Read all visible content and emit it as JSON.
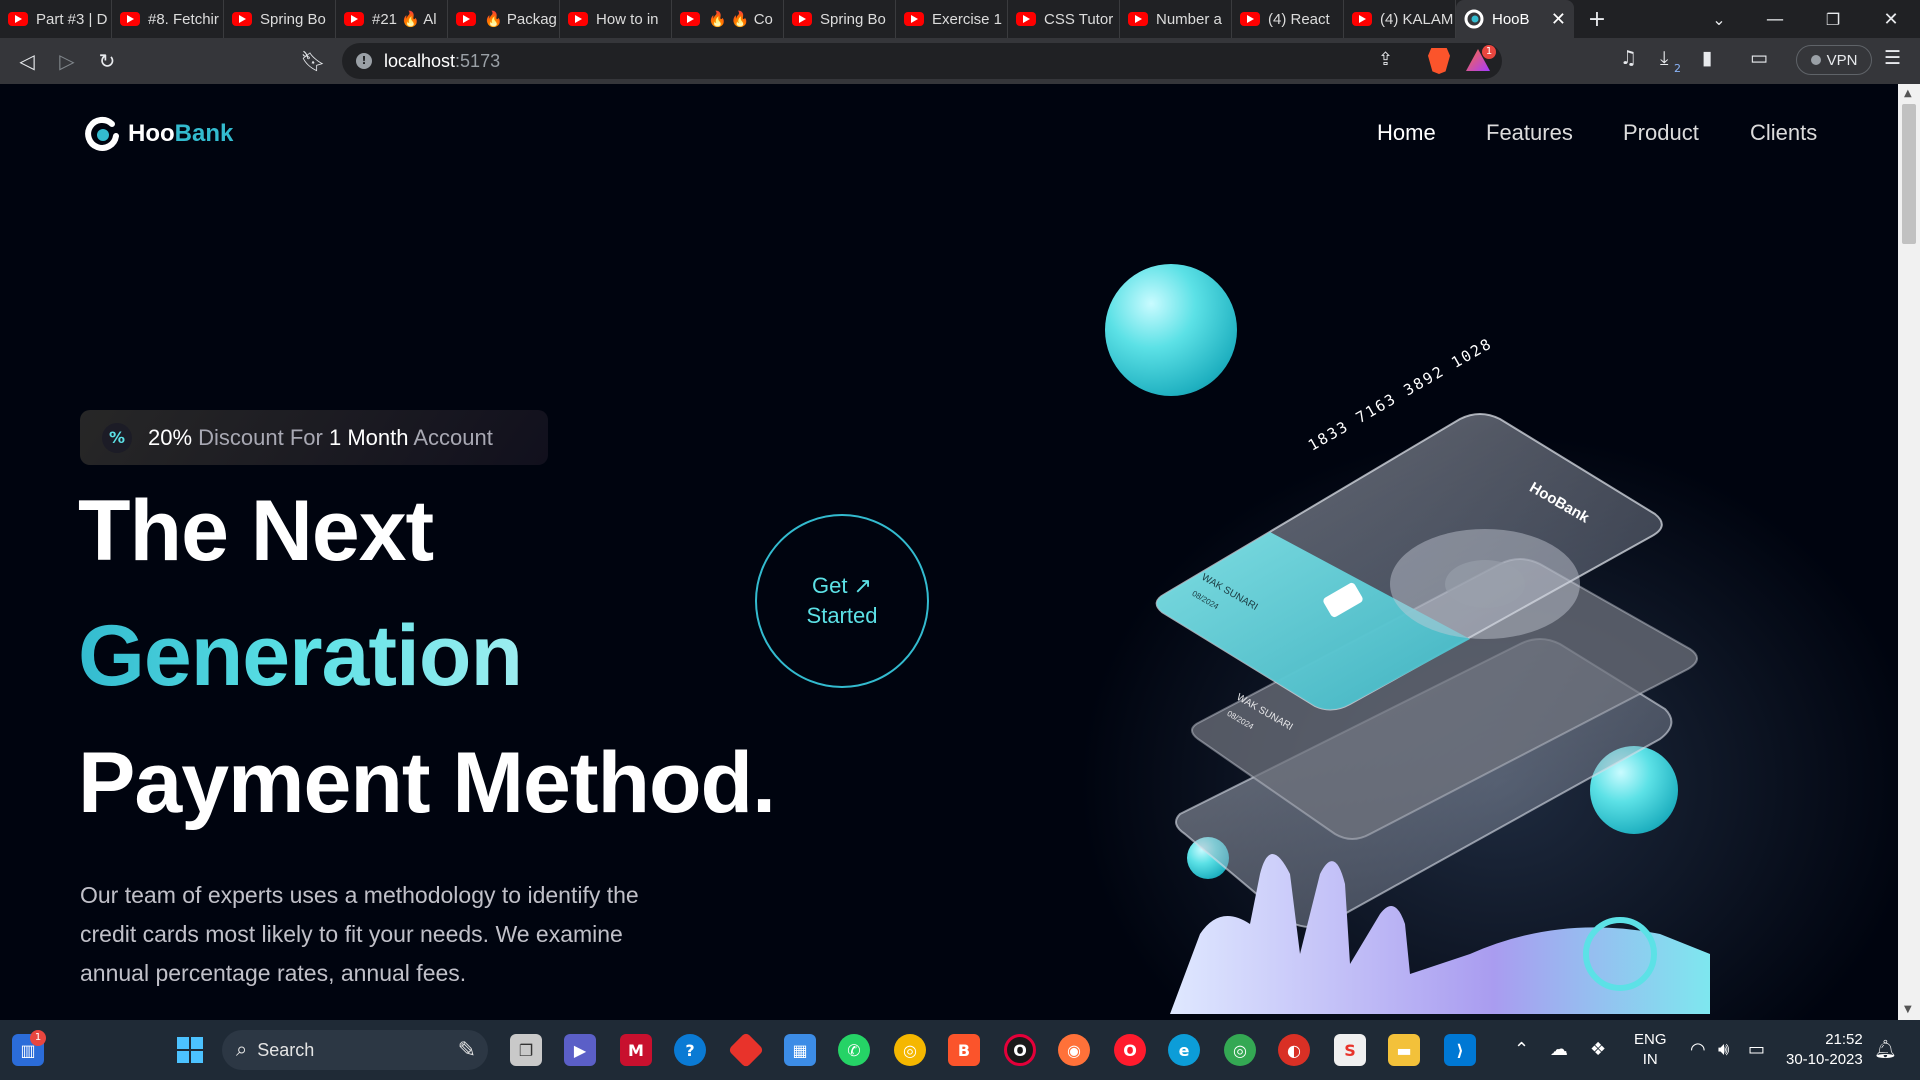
{
  "browser": {
    "tabs": [
      {
        "label": "Part #3 | D",
        "icon": "youtube-icon"
      },
      {
        "label": "#8. Fetchir",
        "icon": "youtube-icon"
      },
      {
        "label": "Spring Bo",
        "icon": "youtube-icon"
      },
      {
        "label": "#21 🔥 Al",
        "icon": "youtube-icon"
      },
      {
        "label": "🔥 Packag",
        "icon": "youtube-icon"
      },
      {
        "label": "How to in",
        "icon": "youtube-icon"
      },
      {
        "label": "🔥 🔥 Co",
        "icon": "youtube-icon"
      },
      {
        "label": "Spring Bo",
        "icon": "youtube-icon"
      },
      {
        "label": "Exercise 1",
        "icon": "youtube-icon"
      },
      {
        "label": "CSS Tutor",
        "icon": "youtube-icon"
      },
      {
        "label": "Number a",
        "icon": "youtube-icon"
      },
      {
        "label": "(4) React",
        "icon": "youtube-icon"
      },
      {
        "label": "(4) KALAM",
        "icon": "youtube-icon"
      }
    ],
    "active_tab": {
      "label": "HooB",
      "icon": "hoobank-icon"
    },
    "new_tab_symbol": "+",
    "url_host": "localhost",
    "url_port": ":5173",
    "brave_rewards_count": "1",
    "download_count": "2",
    "vpn_label": "VPN",
    "accent": "#33bbcf"
  },
  "site": {
    "logo": {
      "part1": "Hoo",
      "part2": "Bank"
    },
    "nav": [
      {
        "label": "Home",
        "active": true
      },
      {
        "label": "Features",
        "active": false
      },
      {
        "label": "Product",
        "active": false
      },
      {
        "label": "Clients",
        "active": false
      }
    ],
    "badge": {
      "pct": "20%",
      "mid": " Discount For ",
      "month": "1 Month",
      "tail": " Account"
    },
    "hero": {
      "line1": "The Next",
      "line2": "Generation",
      "line3": "Payment Method."
    },
    "cta": {
      "line1": "Get",
      "arrow": "↗",
      "line2": "Started"
    },
    "description": "Our team of experts uses a methodology to identify the credit cards most likely to fit your needs. We examine annual percentage rates, annual fees.",
    "card": {
      "number": "1833 7163 3892 1028",
      "brand": "HooBank",
      "holder": "WAK SUNARI",
      "expiry": "08/2024",
      "holder2": "WAK SUNARI",
      "expiry2": "08/2024"
    },
    "colors": {
      "bg": "#00040f",
      "gradient_text": "#5ce1e6",
      "cta_border": "#33bbcf"
    }
  },
  "taskbar": {
    "notification_count": "1",
    "search_placeholder": "Search",
    "lang_top": "ENG",
    "lang_bottom": "IN",
    "time": "21:52",
    "date": "30-10-2023"
  }
}
